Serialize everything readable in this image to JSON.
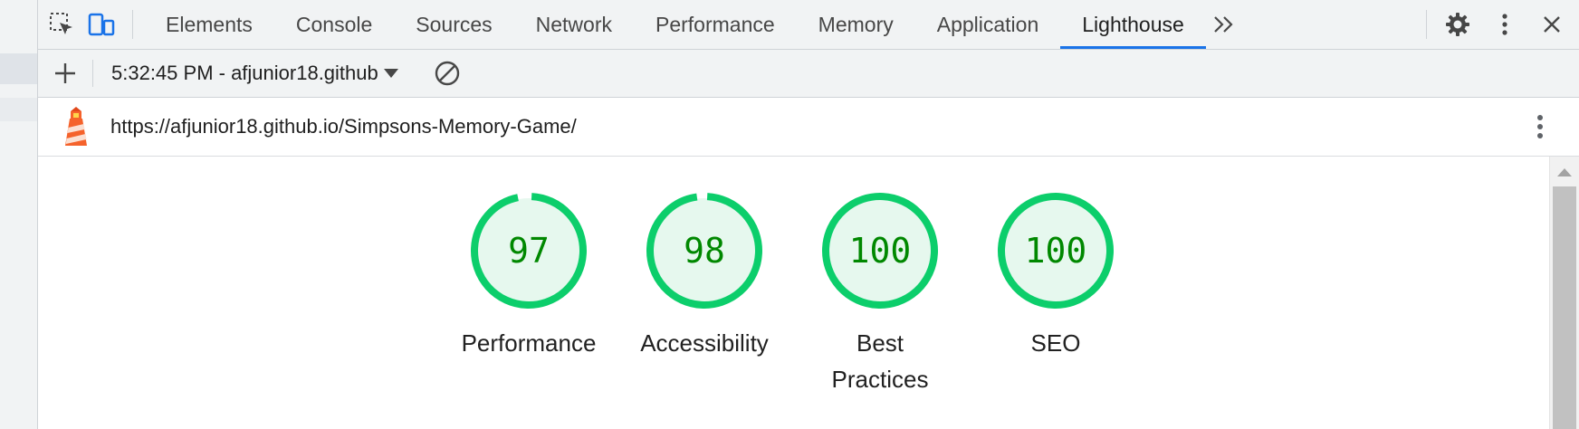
{
  "tabs": [
    {
      "label": "Elements"
    },
    {
      "label": "Console"
    },
    {
      "label": "Sources"
    },
    {
      "label": "Network"
    },
    {
      "label": "Performance"
    },
    {
      "label": "Memory"
    },
    {
      "label": "Application"
    },
    {
      "label": "Lighthouse",
      "active": true
    }
  ],
  "toolbar": {
    "report_selector": "5:32:45 PM - afjunior18.github"
  },
  "report": {
    "url": "https://afjunior18.github.io/Simpsons-Memory-Game/"
  },
  "scores": [
    {
      "label": "Performance",
      "value": 97
    },
    {
      "label": "Accessibility",
      "value": 98
    },
    {
      "label": "Best Practices",
      "value": 100
    },
    {
      "label": "SEO",
      "value": 100
    }
  ],
  "colors": {
    "pass_ring": "#0cce6b",
    "pass_fill": "#e6f8ee",
    "pass_text": "#008800",
    "accent": "#1a73e8"
  },
  "icons": [
    "inspect-element-icon",
    "device-toolbar-icon",
    "more-tabs-icon",
    "settings-gear-icon",
    "kebab-menu-icon",
    "close-icon",
    "plus-icon",
    "clear-block-icon",
    "lighthouse-logo-icon"
  ]
}
